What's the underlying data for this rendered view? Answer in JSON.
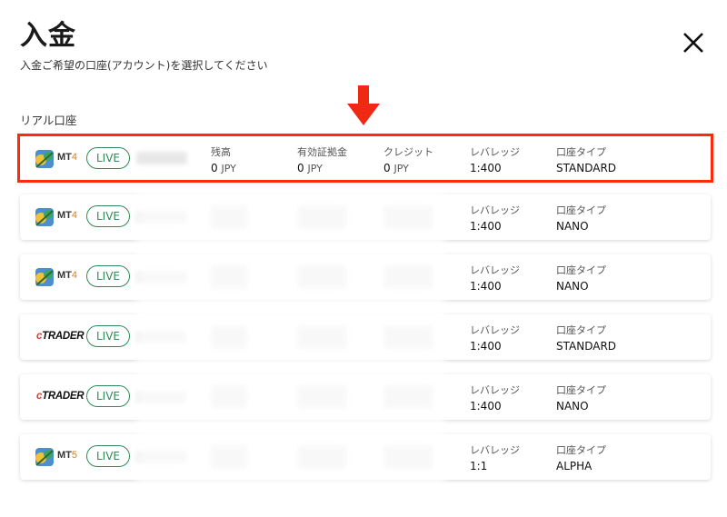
{
  "title": "入金",
  "subtitle": "入金ご希望の口座(アカウント)を選択してください",
  "section_label": "リアル口座",
  "labels": {
    "balance": "残高",
    "equity": "有効証拠金",
    "credit": "クレジット",
    "leverage": "レバレッジ",
    "type": "口座タイプ",
    "currency": "JPY"
  },
  "accounts": [
    {
      "platform": "MT4",
      "badge": "LIVE",
      "balance": "0",
      "equity": "0",
      "credit": "0",
      "leverage": "1:400",
      "type": "STANDARD",
      "highlighted": true
    },
    {
      "platform": "MT4",
      "badge": "LIVE",
      "leverage": "1:400",
      "type": "NANO"
    },
    {
      "platform": "MT4",
      "badge": "LIVE",
      "leverage": "1:400",
      "type": "NANO"
    },
    {
      "platform": "cTrader",
      "badge": "LIVE",
      "leverage": "1:400",
      "type": "STANDARD"
    },
    {
      "platform": "cTrader",
      "badge": "LIVE",
      "leverage": "1:400",
      "type": "NANO"
    },
    {
      "platform": "MT5",
      "badge": "LIVE",
      "leverage": "1:1",
      "type": "ALPHA"
    }
  ],
  "icons": {
    "close": "close-icon",
    "arrow": "red-down-arrow-icon",
    "mt": "metatrader-icon"
  },
  "colors": {
    "highlight": "#ff2a0a",
    "live": "#2e8b57",
    "arrow": "#f02a12"
  }
}
